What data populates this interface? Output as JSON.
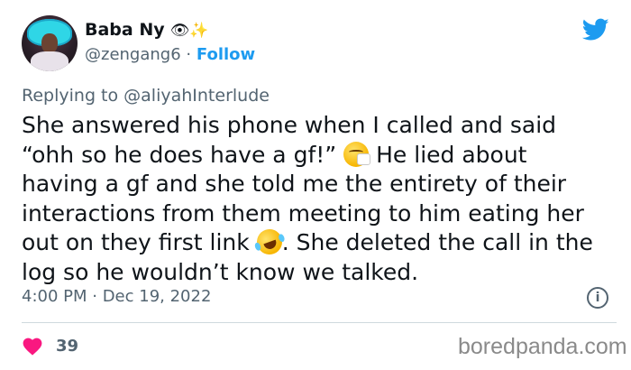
{
  "user": {
    "display_name": "Baba Ny",
    "name_emojis": "👁✨",
    "handle": "@zengang6",
    "separator": "·",
    "follow_label": "Follow"
  },
  "reply": {
    "prefix": "Replying to ",
    "mention": "@aliyahInterlude"
  },
  "tweet": {
    "line1": "She answered his phone when I called and said",
    "line2a": "“ohh so he does have a gf!” ",
    "line2b": " He lied about",
    "line3": "having a gf and she told me the entirety of their",
    "line4": "interactions from them meeting to him eating her",
    "line5a": "out on they first link ",
    "line5b": ". She deleted the call in the",
    "line6": "log so he wouldn’t know we talked."
  },
  "meta": {
    "timestamp": "4:00 PM · Dec 19, 2022",
    "info_glyph": "i"
  },
  "stats": {
    "likes": "39"
  },
  "watermark": "boredpanda.com",
  "colors": {
    "link": "#1d9bf0",
    "secondary_text": "#536471",
    "heart": "#f91880",
    "twitter_blue": "#1d9bf0"
  },
  "icons": {
    "logo": "twitter-bird-icon",
    "emoji_1": "sneezing-face-icon",
    "emoji_2": "rolling-on-floor-laughing-icon",
    "info": "info-icon",
    "like": "heart-icon"
  }
}
